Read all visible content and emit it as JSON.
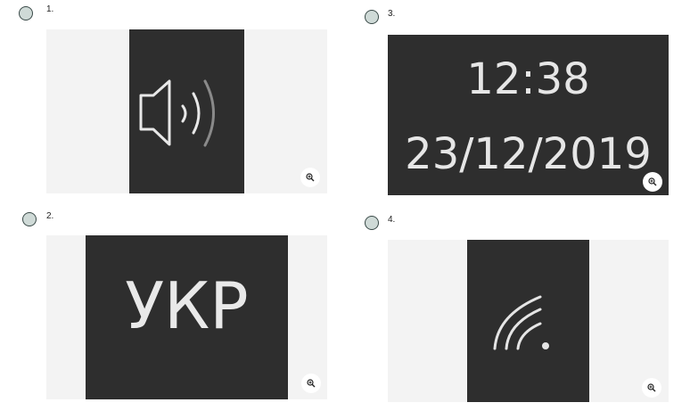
{
  "options": [
    {
      "number": "1.",
      "icon": "speaker-icon"
    },
    {
      "number": "2.",
      "language": "УКР"
    },
    {
      "number": "3.",
      "time": "12:38",
      "date": "23/12/2019"
    },
    {
      "number": "4.",
      "icon": "wifi-icon"
    }
  ],
  "zoom_icon": "zoom-in-icon"
}
